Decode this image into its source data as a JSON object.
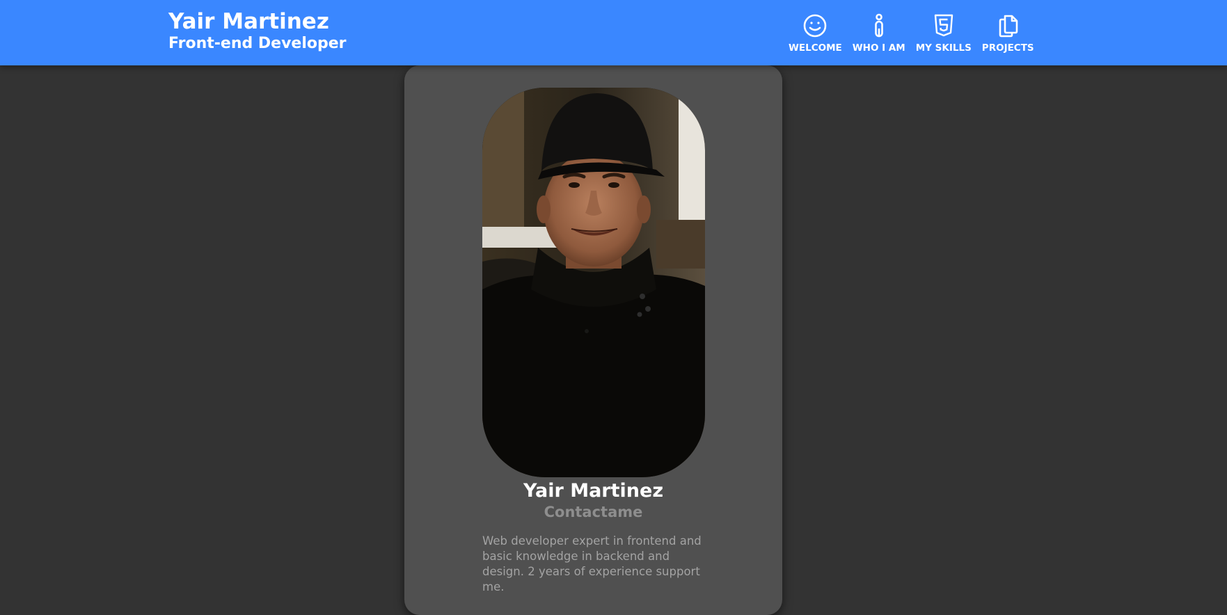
{
  "header": {
    "name": "Yair Martinez",
    "role": "Front-end Developer",
    "nav": [
      {
        "label": "WELCOME",
        "icon": "smiley-face-icon"
      },
      {
        "label": "WHO I AM",
        "icon": "person-icon"
      },
      {
        "label": "MY SKILLS",
        "icon": "html5-icon"
      },
      {
        "label": "PROJECTS",
        "icon": "copy-files-icon"
      }
    ]
  },
  "profile": {
    "photo": "profile-photo",
    "name": "Yair Martinez",
    "contact": "Contactame",
    "bio": "Web developer expert in frontend and basic knowledge in backend and design. 2 years of experience support me."
  },
  "colors": {
    "header_bg": "#3a87ff",
    "page_bg": "#333333",
    "card_bg": "#505050",
    "contact_text": "#8e8e8e",
    "bio_text": "#a3a3a3"
  }
}
